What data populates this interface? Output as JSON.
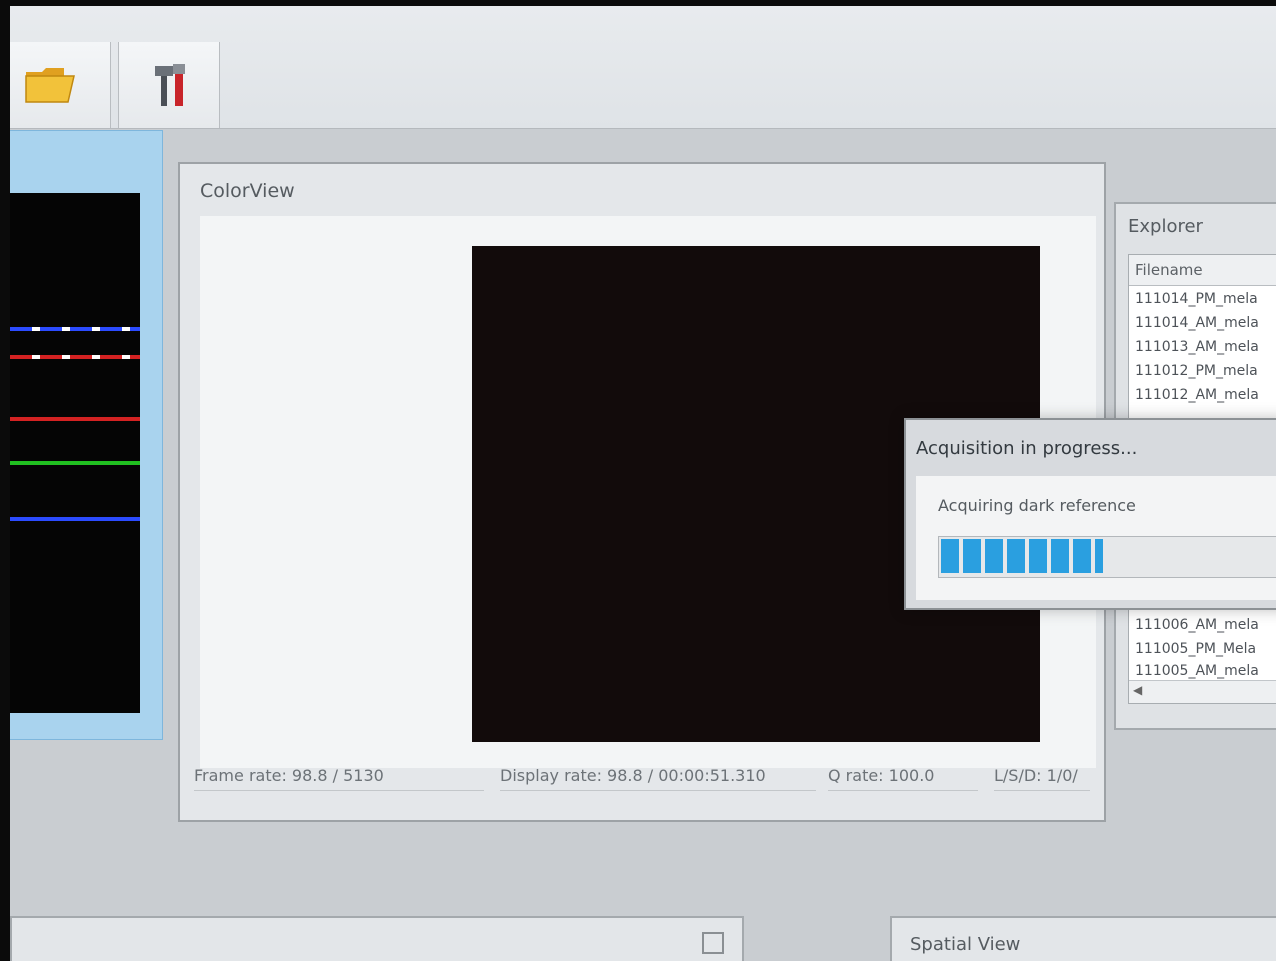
{
  "toolbar": {
    "open_icon": "folder-open-icon",
    "tools_icon": "tools-icon"
  },
  "color_view": {
    "title": "ColorView",
    "status": {
      "frame_rate": "Frame rate: 98.8 / 5130",
      "display_rate": "Display rate: 98.8 / 00:00:51.310",
      "q_rate": "Q rate: 100.0",
      "lsd": "L/S/D: 1/0/"
    }
  },
  "explorer": {
    "title": "Explorer",
    "column_header": "Filename",
    "files_top": [
      "111014_PM_mela",
      "111014_AM_mela",
      "111013_AM_mela",
      "111012_PM_mela",
      "111012_AM_mela"
    ],
    "files_bottom": [
      "111006_AM_mela",
      "111005_PM_Mela",
      "111005_AM_mela"
    ]
  },
  "dialog": {
    "title": "Acquisition in progress...",
    "message": "Acquiring dark reference",
    "progress_fraction": 0.43
  },
  "spatial_view": {
    "title": "Spatial View"
  },
  "colors": {
    "progress": "#2a9fe0",
    "spectrum_blue": "#2b4bff",
    "spectrum_red": "#d42222",
    "spectrum_green": "#21c021"
  }
}
